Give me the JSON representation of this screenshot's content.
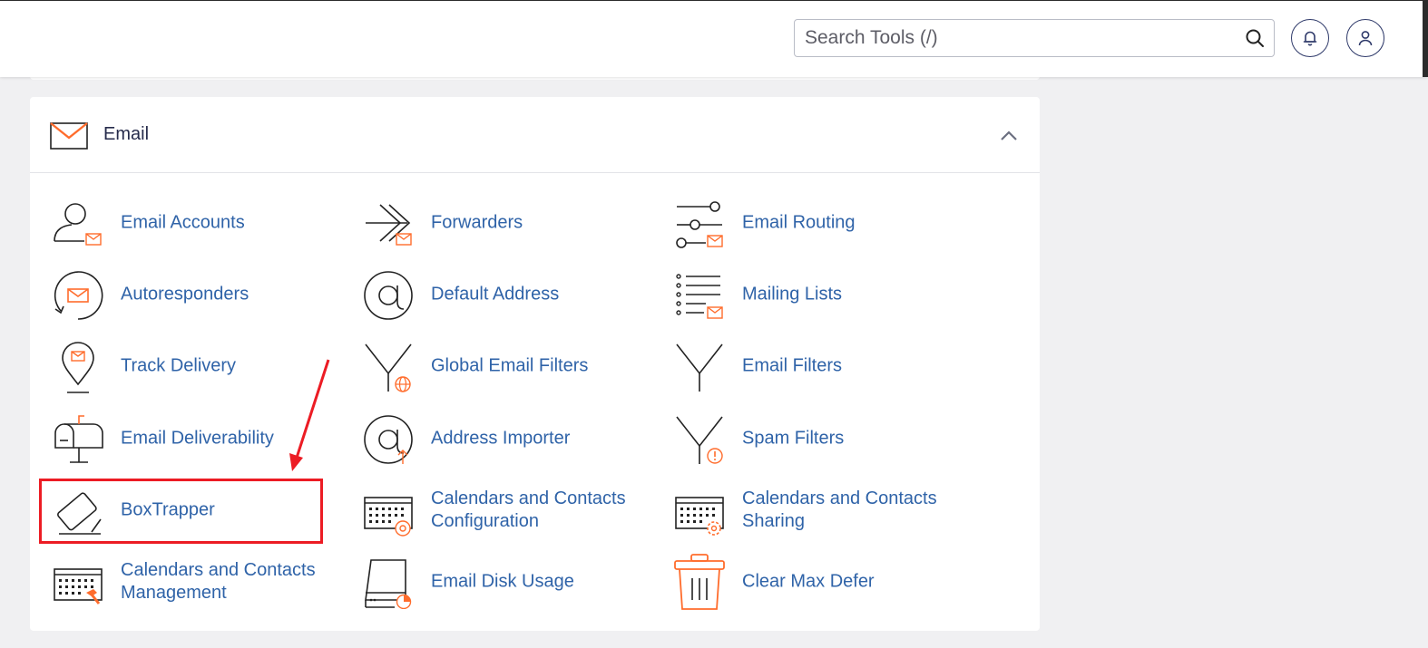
{
  "header": {
    "search_placeholder": "Search Tools (/)"
  },
  "email_section": {
    "title": "Email",
    "tools": [
      {
        "label": "Email Accounts"
      },
      {
        "label": "Forwarders"
      },
      {
        "label": "Email Routing"
      },
      {
        "label": "Autoresponders"
      },
      {
        "label": "Default Address"
      },
      {
        "label": "Mailing Lists"
      },
      {
        "label": "Track Delivery"
      },
      {
        "label": "Global Email Filters"
      },
      {
        "label": "Email Filters"
      },
      {
        "label": "Email Deliverability"
      },
      {
        "label": "Address Importer"
      },
      {
        "label": "Spam Filters"
      },
      {
        "label": "BoxTrapper"
      },
      {
        "label": "Calendars and Contacts Configuration"
      },
      {
        "label": "Calendars and Contacts Sharing"
      },
      {
        "label": "Calendars and Contacts Management"
      },
      {
        "label": "Email Disk Usage"
      },
      {
        "label": "Clear Max Defer"
      }
    ]
  },
  "colors": {
    "accent_orange": "#ff6c2c",
    "link_blue": "#2f63a8",
    "annotation_red": "#ec1c24"
  }
}
